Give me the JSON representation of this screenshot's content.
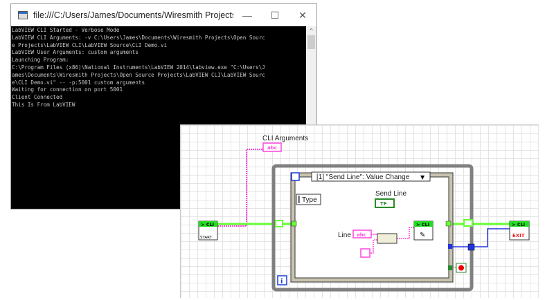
{
  "console_window": {
    "title": "file:///C:/Users/James/Documents/Wiresmith Projects/Ope...",
    "controls": {
      "minimize": "—",
      "maximize": "☐",
      "close": "✕"
    },
    "lines": [
      "LabVIEW CLI Started - Verbose Mode",
      "LabVIEW CLI Arguments: -v C:\\Users\\James\\Documents\\Wiresmith Projects\\Open Sourc",
      "e Projects\\LabVIEW CLI\\LabVIEW Source\\CLI Demo.vi",
      "LabVIEW User Arguments: custom arguments",
      "Launching Program:",
      "C:\\Program Files (x86)\\National Instruments\\LabVIEW 2014\\labview.exe \"C:\\Users\\J",
      "ames\\Documents\\Wiresmith Projects\\Open Source Projects\\LabVIEW CLI\\LabVIEW Sourc",
      "e\\CLI Demo.vi\" -- -p:5001 custom arguments",
      "Waiting for connection on port 5001",
      "Client Connected",
      "This Is From LabVIEW"
    ]
  },
  "block_diagram": {
    "cli_arguments_label": "CLI Arguments",
    "string_glyph": "abc",
    "event_case_selector": "[1] \"Send Line\": Value Change",
    "type_label": "Type",
    "send_line_label": "Send Line",
    "bool_glyph": "TF",
    "line_label": "Line",
    "cli_node_label": "> CLI",
    "start_label": "START",
    "exit_label": "EXIT",
    "loop_iteration": "i",
    "colors": {
      "cli_wire": "#66ff33",
      "string_wire": "#ff44dd",
      "error_wire": "#2233dd",
      "loop_frame": "#808080"
    }
  }
}
